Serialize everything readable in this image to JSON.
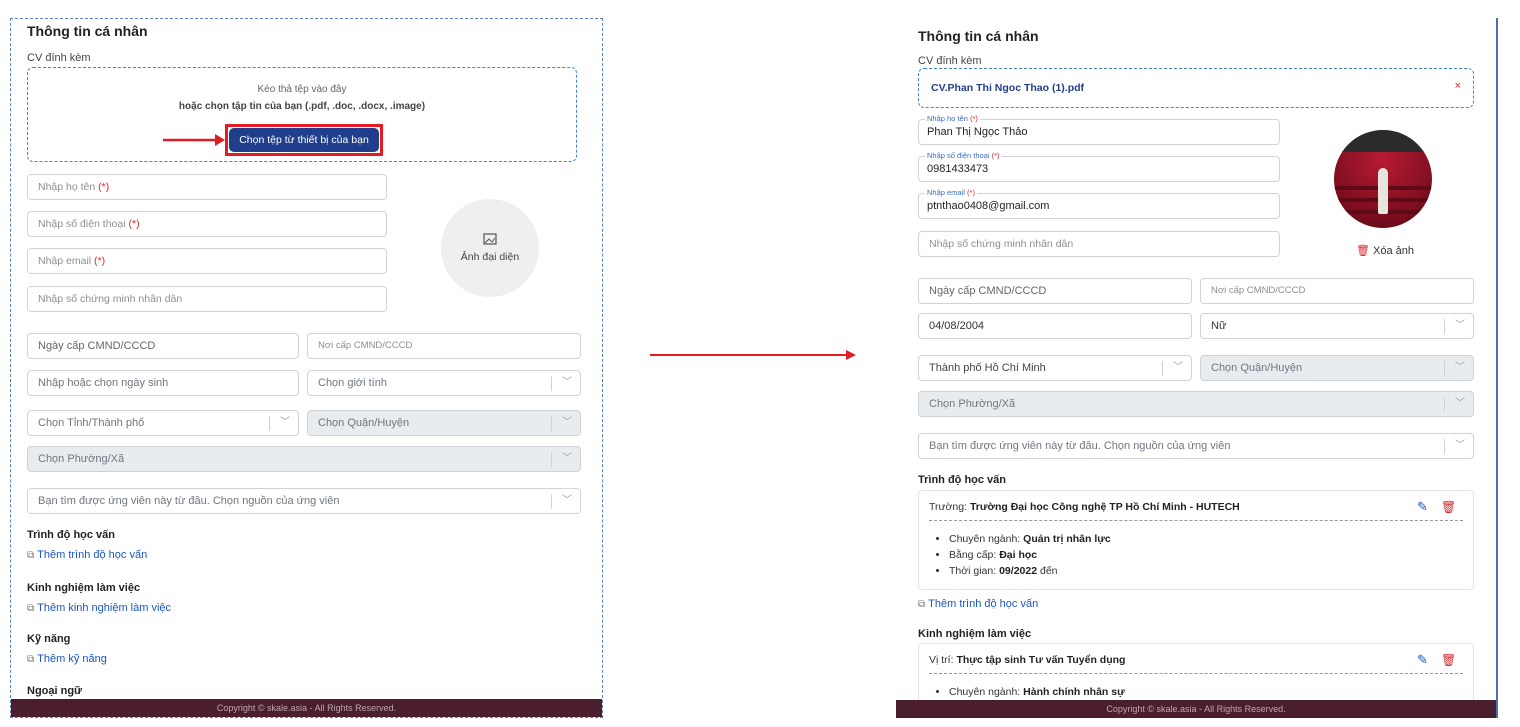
{
  "left": {
    "title": "Thông tin cá nhân",
    "cv_label": "CV đính kèm",
    "drop_line1": "Kéo thả tệp vào đây",
    "drop_line2": "hoặc chọn tập tin của bạn (.pdf, .doc, .docx, .image)",
    "choose_button": "Chọn tệp từ thiết bị của bạn",
    "name_placeholder": "Nhập họ tên",
    "phone_placeholder": "Nhập số điện thoại",
    "email_placeholder": "Nhập email",
    "required_mark": "(*)",
    "id_placeholder": "Nhập số chứng minh nhân dân",
    "avatar_label": "Ảnh đại diện",
    "issue_date_placeholder": "Ngày cấp CMND/CCCD",
    "issue_place_placeholder": "Nơi cấp CMND/CCCD",
    "birth_placeholder": "Nhập hoặc chọn ngày sinh",
    "gender_placeholder": "Chọn giới tính",
    "province_placeholder": "Chọn Tỉnh/Thành phố",
    "district_placeholder": "Chọn Quận/Huyện",
    "ward_placeholder": "Chọn Phường/Xã",
    "source_placeholder": "Bạn tìm được ứng viên này từ đâu. Chọn nguồn của ứng viên",
    "education_title": "Trình độ học vấn",
    "add_education": "Thêm trình độ học vấn",
    "experience_title": "Kinh nghiệm làm việc",
    "add_experience": "Thêm kinh nghiệm làm việc",
    "skills_title": "Kỹ năng",
    "add_skills": "Thêm kỹ năng",
    "language_title": "Ngoại ngữ",
    "footer": "Copyright © skale.asia - All Rights Reserved."
  },
  "right": {
    "title": "Thông tin cá nhân",
    "cv_label": "CV đính kèm",
    "cv_file": "CV.Phan Thi Ngoc Thao (1).pdf",
    "remove_x": "×",
    "name_label": "Nhập họ tên",
    "name_value": "Phan Thị Ngọc Thảo",
    "phone_label": "Nhập số điện thoại",
    "phone_value": "0981433473",
    "email_label": "Nhập email",
    "email_value": "ptnthao0408@gmail.com",
    "required_mark": "(*)",
    "id_placeholder": "Nhập số chứng minh nhân dân",
    "delete_photo": "Xóa ảnh",
    "issue_date_placeholder": "Ngày cấp CMND/CCCD",
    "issue_place_placeholder": "Nơi cấp CMND/CCCD",
    "birth_value": "04/08/2004",
    "gender_value": "Nữ",
    "province_value": "Thành phố Hồ Chí Minh",
    "district_placeholder": "Chọn Quận/Huyện",
    "ward_placeholder": "Chọn Phường/Xã",
    "source_placeholder": "Bạn tìm được ứng viên này từ đâu. Chọn nguồn của ứng viên",
    "education_title": "Trình độ học vấn",
    "edu_school_label": "Trường:",
    "edu_school": "Trường Đại học Công nghệ TP Hồ Chí Minh - HUTECH",
    "edu_major_label": "Chuyên ngành:",
    "edu_major": "Quản trị nhân lực",
    "edu_degree_label": "Bằng cấp:",
    "edu_degree": "Đại học",
    "edu_time_label": "Thời gian:",
    "edu_time": "09/2022",
    "edu_time_suffix": "đến",
    "add_education": "Thêm trình độ học vấn",
    "experience_title": "Kinh nghiệm làm việc",
    "exp_position_label": "Vị trí:",
    "exp_position": "Thực tập sinh Tư vấn Tuyển dụng",
    "exp_major_label": "Chuyên ngành:",
    "exp_major": "Hành chính nhân sự",
    "footer": "Copyright © skale.asia - All Rights Reserved."
  },
  "colors": {
    "accent_red": "#e31b23",
    "button_blue": "#1f3f8c",
    "link_blue": "#1a56c4",
    "footer_bg": "#4b1e2e"
  }
}
